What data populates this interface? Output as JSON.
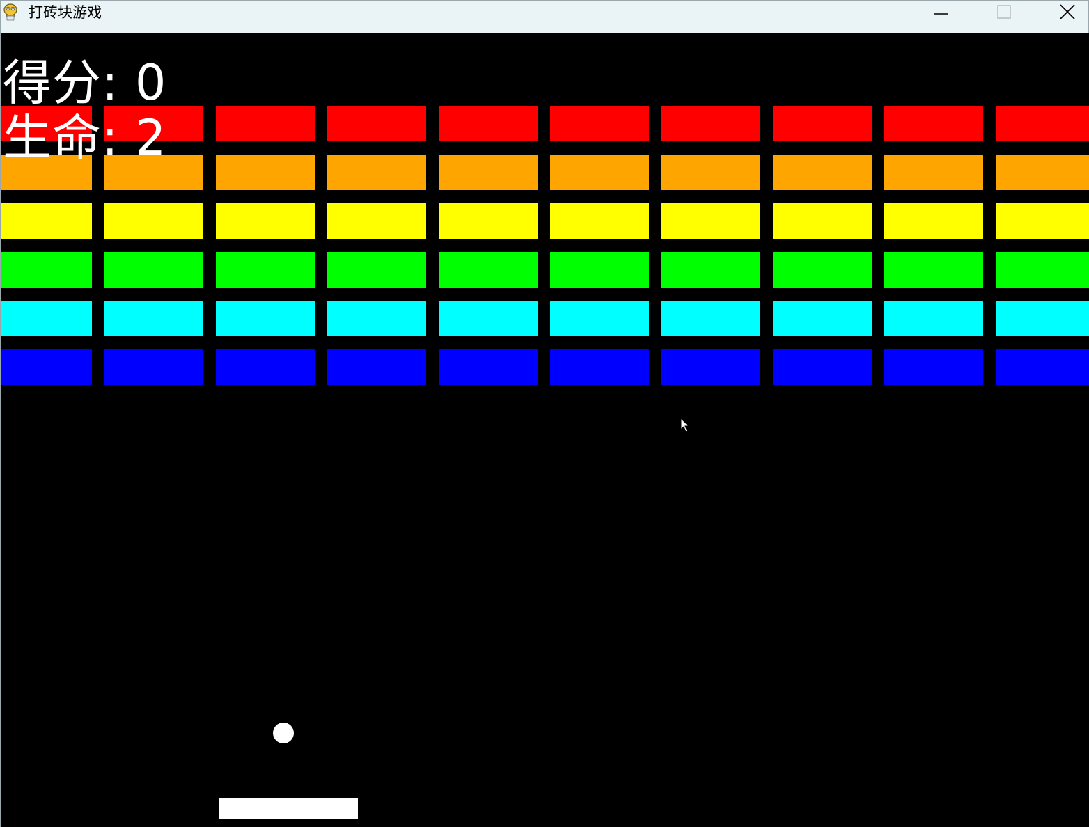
{
  "window": {
    "title": "打砖块游戏",
    "icon": "pygame-snake-icon",
    "controls": [
      "minimize-icon",
      "maximize-icon",
      "close-icon"
    ]
  },
  "hud": {
    "score_text": "得分: 0",
    "lives_text": "生命: 2",
    "score": 0,
    "lives": 2
  },
  "bricks": {
    "rows": 6,
    "columns": 10,
    "row_colors": [
      "#ff0000",
      "#ffa500",
      "#ffff00",
      "#00ff00",
      "#00ffff",
      "#0000ff"
    ]
  },
  "colors": {
    "background": "#000000",
    "ball": "#ffffff",
    "paddle": "#ffffff",
    "text": "#ffffff"
  }
}
